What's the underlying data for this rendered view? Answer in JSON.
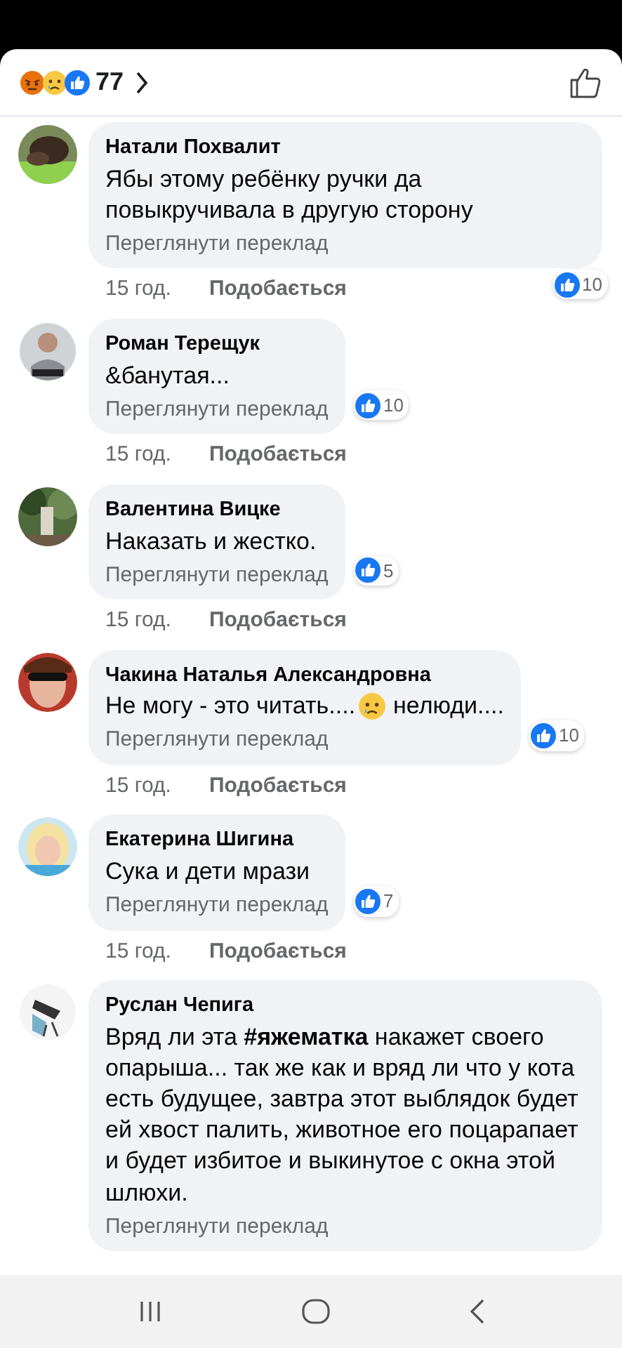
{
  "reactions_bar": {
    "count": "77",
    "reactions": [
      {
        "kind": "angry"
      },
      {
        "kind": "sad"
      },
      {
        "kind": "like"
      }
    ]
  },
  "comments": [
    {
      "author": "Натали Похвалит",
      "body": [
        {
          "kind": "text",
          "text": "Ябы этому ребёнку ручки да повыкручивала в другую сторону"
        }
      ],
      "translate": "Переглянути переклад",
      "time": "15 год.",
      "like_label": "Подобається",
      "likes": "10"
    },
    {
      "author": "Роман Терещук",
      "body": [
        {
          "kind": "text",
          "text": "&банутая..."
        }
      ],
      "translate": "Переглянути переклад",
      "time": "15 год.",
      "like_label": "Подобається",
      "likes": "10"
    },
    {
      "author": "Валентина Вицке",
      "body": [
        {
          "kind": "text",
          "text": "Наказать и жестко."
        }
      ],
      "translate": "Переглянути переклад",
      "time": "15 год.",
      "like_label": "Подобається",
      "likes": "5"
    },
    {
      "author": "Чакина Наталья Александровна",
      "body": [
        {
          "kind": "text",
          "text": "Не могу - это читать...."
        },
        {
          "kind": "emoji"
        },
        {
          "kind": "text",
          "text": "нелюди...."
        }
      ],
      "translate": "Переглянути переклад",
      "time": "15 год.",
      "like_label": "Подобається",
      "likes": "10"
    },
    {
      "author": "Екатерина Шигина",
      "body": [
        {
          "kind": "text",
          "text": "Сука и дети мрази"
        }
      ],
      "translate": "Переглянути переклад",
      "time": "15 год.",
      "like_label": "Подобається",
      "likes": "7"
    },
    {
      "author": "Руслан Чепига",
      "body": [
        {
          "kind": "text",
          "text": "Вряд ли эта **#яжематка** накажет своего опарыша... так же как и вряд ли что у кота есть будущее, завтра этот выблядок будет ей хвост палить, животное его поцарапает и будет избитое и выкинутое с окна этой шлюхи."
        }
      ],
      "translate": "Переглянути переклад"
    }
  ]
}
